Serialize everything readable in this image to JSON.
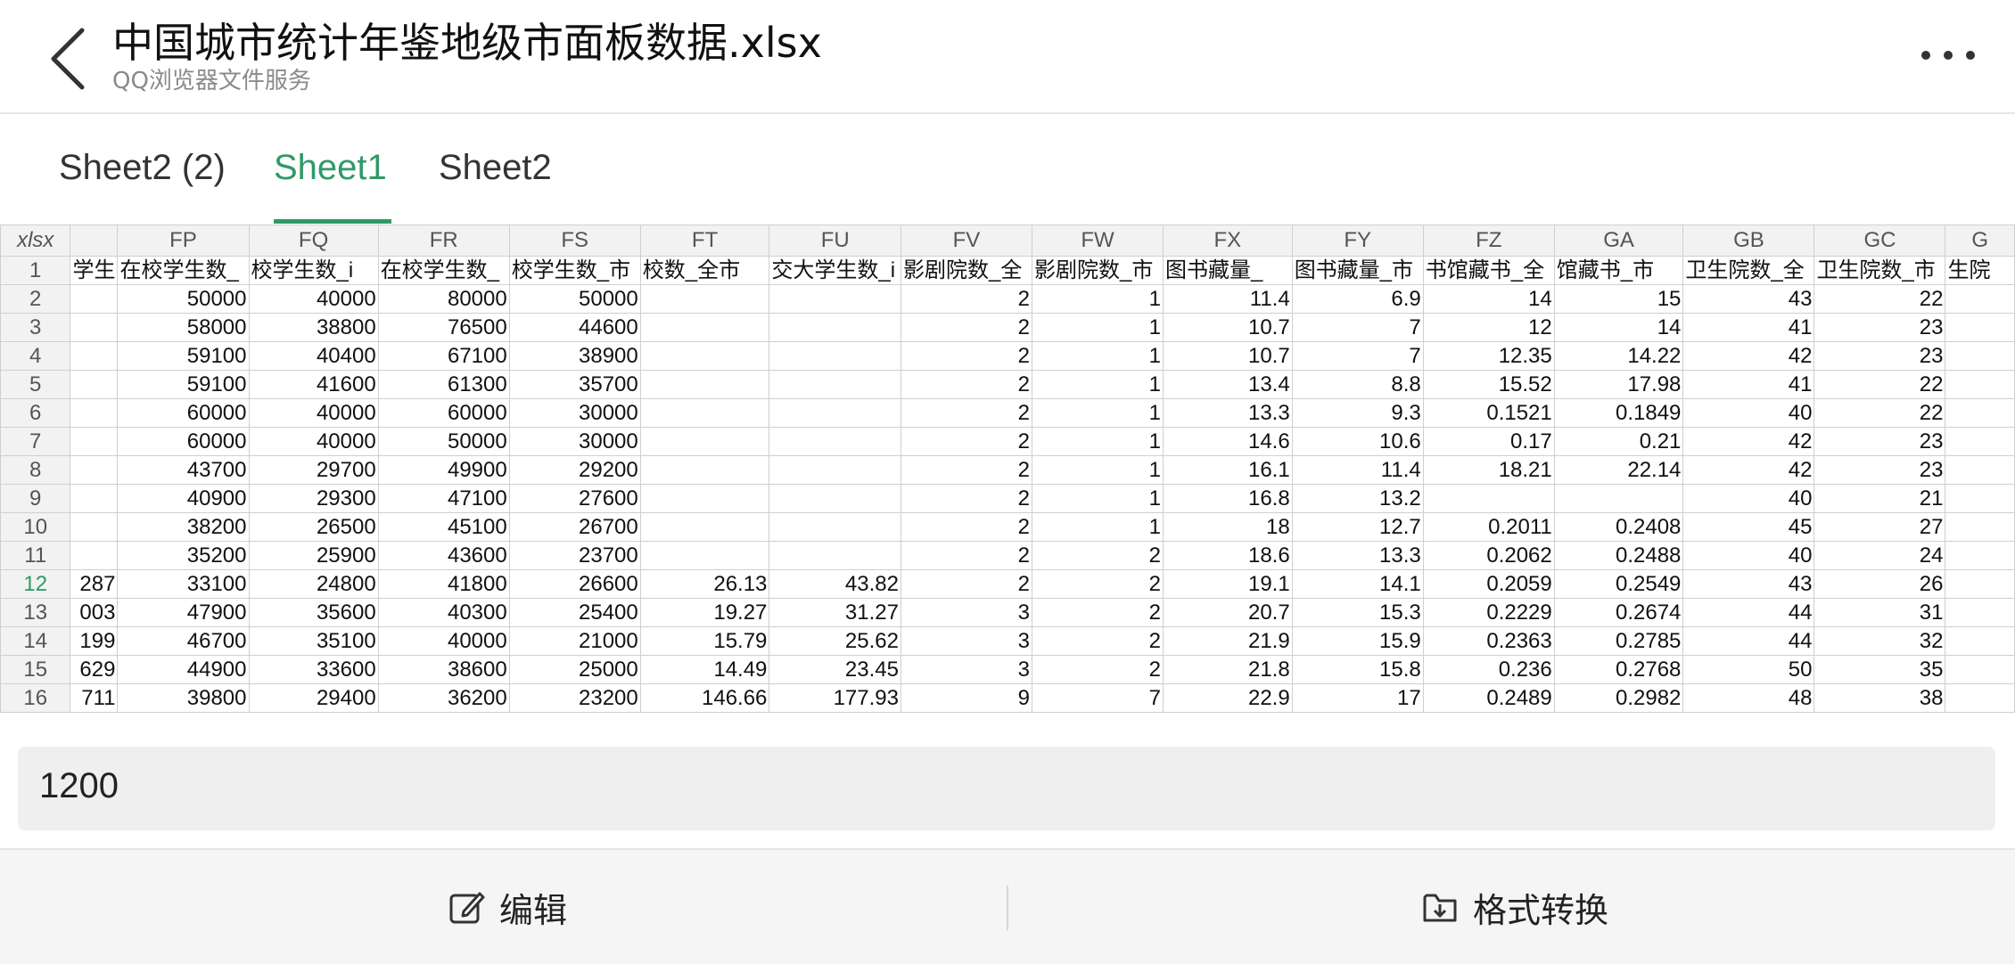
{
  "header": {
    "title": "中国城市统计年鉴地级市面板数据.xlsx",
    "subtitle": "QQ浏览器文件服务",
    "back_icon": "chevron-left-icon",
    "more_icon": "more-horizontal-icon"
  },
  "tabs": [
    {
      "label": "Sheet2 (2)",
      "active": false
    },
    {
      "label": "Sheet1",
      "active": true
    },
    {
      "label": "Sheet2",
      "active": false
    }
  ],
  "accent_color": "#2f9a67",
  "sheet": {
    "corner_label": "xlsx",
    "partial_left_col": "",
    "columns": [
      "FP",
      "FQ",
      "FR",
      "FS",
      "FT",
      "FU",
      "FV",
      "FW",
      "FX",
      "FY",
      "FZ",
      "GA",
      "GB",
      "GC",
      "G"
    ],
    "header_row": {
      "row_num": "1",
      "partial_left": "学生",
      "cells": [
        "在校学生数_",
        "校学生数_i",
        "在校学生数_",
        "校学生数_市",
        "校数_全市",
        "交大学生数_i",
        "影剧院数_全",
        "影剧院数_市",
        "图书藏量_",
        "图书藏量_市",
        "书馆藏书_全",
        "馆藏书_市",
        "卫生院数_全",
        "卫生院数_市",
        "生院"
      ]
    },
    "rows": [
      {
        "num": "2",
        "left": "",
        "cells": [
          "50000",
          "40000",
          "80000",
          "50000",
          "",
          "",
          "2",
          "1",
          "11.4",
          "6.9",
          "14",
          "15",
          "43",
          "22",
          ""
        ]
      },
      {
        "num": "3",
        "left": "",
        "cells": [
          "58000",
          "38800",
          "76500",
          "44600",
          "",
          "",
          "2",
          "1",
          "10.7",
          "7",
          "12",
          "14",
          "41",
          "23",
          ""
        ]
      },
      {
        "num": "4",
        "left": "",
        "cells": [
          "59100",
          "40400",
          "67100",
          "38900",
          "",
          "",
          "2",
          "1",
          "10.7",
          "7",
          "12.35",
          "14.22",
          "42",
          "23",
          ""
        ]
      },
      {
        "num": "5",
        "left": "",
        "cells": [
          "59100",
          "41600",
          "61300",
          "35700",
          "",
          "",
          "2",
          "1",
          "13.4",
          "8.8",
          "15.52",
          "17.98",
          "41",
          "22",
          ""
        ]
      },
      {
        "num": "6",
        "left": "",
        "cells": [
          "60000",
          "40000",
          "60000",
          "30000",
          "",
          "",
          "2",
          "1",
          "13.3",
          "9.3",
          "0.1521",
          "0.1849",
          "40",
          "22",
          ""
        ]
      },
      {
        "num": "7",
        "left": "",
        "cells": [
          "60000",
          "40000",
          "50000",
          "30000",
          "",
          "",
          "2",
          "1",
          "14.6",
          "10.6",
          "0.17",
          "0.21",
          "42",
          "23",
          ""
        ]
      },
      {
        "num": "8",
        "left": "",
        "cells": [
          "43700",
          "29700",
          "49900",
          "29200",
          "",
          "",
          "2",
          "1",
          "16.1",
          "11.4",
          "18.21",
          "22.14",
          "42",
          "23",
          ""
        ]
      },
      {
        "num": "9",
        "left": "",
        "cells": [
          "40900",
          "29300",
          "47100",
          "27600",
          "",
          "",
          "2",
          "1",
          "16.8",
          "13.2",
          "",
          "",
          "40",
          "21",
          ""
        ]
      },
      {
        "num": "10",
        "left": "",
        "cells": [
          "38200",
          "26500",
          "45100",
          "26700",
          "",
          "",
          "2",
          "1",
          "18",
          "12.7",
          "0.2011",
          "0.2408",
          "45",
          "27",
          ""
        ]
      },
      {
        "num": "11",
        "left": "",
        "cells": [
          "35200",
          "25900",
          "43600",
          "23700",
          "",
          "",
          "2",
          "2",
          "18.6",
          "13.3",
          "0.2062",
          "0.2488",
          "40",
          "24",
          ""
        ]
      },
      {
        "num": "12",
        "left": "287",
        "cells": [
          "33100",
          "24800",
          "41800",
          "26600",
          "26.13",
          "43.82",
          "2",
          "2",
          "19.1",
          "14.1",
          "0.2059",
          "0.2549",
          "43",
          "26",
          ""
        ]
      },
      {
        "num": "13",
        "left": "003",
        "cells": [
          "47900",
          "35600",
          "40300",
          "25400",
          "19.27",
          "31.27",
          "3",
          "2",
          "20.7",
          "15.3",
          "0.2229",
          "0.2674",
          "44",
          "31",
          ""
        ]
      },
      {
        "num": "14",
        "left": "199",
        "cells": [
          "46700",
          "35100",
          "40000",
          "21000",
          "15.79",
          "25.62",
          "3",
          "2",
          "21.9",
          "15.9",
          "0.2363",
          "0.2785",
          "44",
          "32",
          ""
        ]
      },
      {
        "num": "15",
        "left": "629",
        "cells": [
          "44900",
          "33600",
          "38600",
          "25000",
          "14.49",
          "23.45",
          "3",
          "2",
          "21.8",
          "15.8",
          "0.236",
          "0.2768",
          "50",
          "35",
          ""
        ]
      },
      {
        "num": "16",
        "left": "711",
        "cells": [
          "39800",
          "29400",
          "36200",
          "23200",
          "146.66",
          "177.93",
          "9",
          "7",
          "22.9",
          "17",
          "0.2489",
          "0.2982",
          "48",
          "38",
          ""
        ]
      }
    ],
    "active_row": "12"
  },
  "formula_bar": {
    "value": "1200"
  },
  "toolbar": {
    "edit_label": "编辑",
    "edit_icon": "edit-icon",
    "convert_label": "格式转换",
    "convert_icon": "folder-download-icon"
  }
}
